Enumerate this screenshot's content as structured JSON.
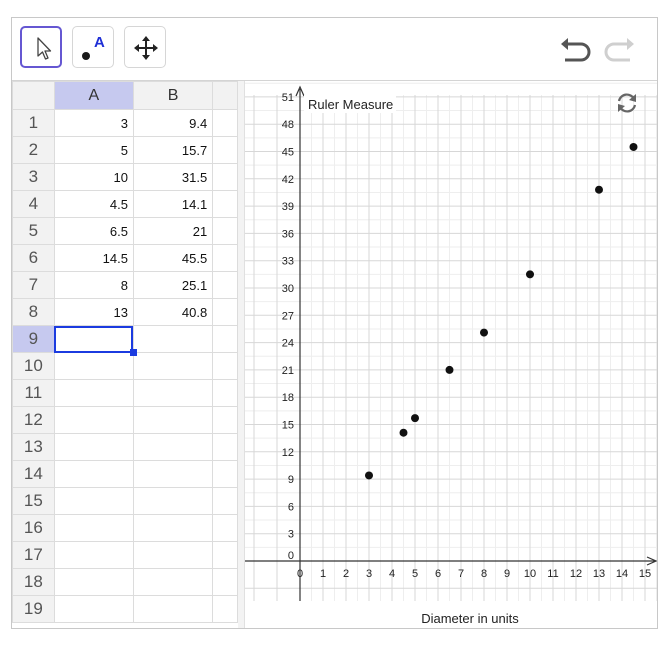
{
  "toolbar": {
    "tools": [
      {
        "name": "move-tool",
        "icon": "cursor-arrow-icon",
        "selected": true
      },
      {
        "name": "point-tool",
        "icon": "point-icon",
        "label": "A",
        "selected": false
      },
      {
        "name": "move-graphics-tool",
        "icon": "move-arrows-icon",
        "selected": false
      }
    ],
    "undo_icon": "undo-icon",
    "redo_icon": "redo-icon",
    "accent": "#6557d2"
  },
  "spreadsheet": {
    "columns": [
      "A",
      "B"
    ],
    "rows": [
      {
        "n": "1",
        "a": "3",
        "b": "9.4"
      },
      {
        "n": "2",
        "a": "5",
        "b": "15.7"
      },
      {
        "n": "3",
        "a": "10",
        "b": "31.5"
      },
      {
        "n": "4",
        "a": "4.5",
        "b": "14.1"
      },
      {
        "n": "5",
        "a": "6.5",
        "b": "21"
      },
      {
        "n": "6",
        "a": "14.5",
        "b": "45.5"
      },
      {
        "n": "7",
        "a": "8",
        "b": "25.1"
      },
      {
        "n": "8",
        "a": "13",
        "b": "40.8"
      },
      {
        "n": "9",
        "a": "",
        "b": ""
      },
      {
        "n": "10",
        "a": "",
        "b": ""
      },
      {
        "n": "11",
        "a": "",
        "b": ""
      },
      {
        "n": "12",
        "a": "",
        "b": ""
      },
      {
        "n": "13",
        "a": "",
        "b": ""
      },
      {
        "n": "14",
        "a": "",
        "b": ""
      },
      {
        "n": "15",
        "a": "",
        "b": ""
      },
      {
        "n": "16",
        "a": "",
        "b": ""
      },
      {
        "n": "17",
        "a": "",
        "b": ""
      },
      {
        "n": "18",
        "a": "",
        "b": ""
      },
      {
        "n": "19",
        "a": "",
        "b": ""
      }
    ],
    "selected_cell": "A9",
    "header_highlight": "#c6c9ef",
    "selection_color": "#1b3be0"
  },
  "graphics": {
    "refresh_icon": "refresh-icon"
  },
  "chart_data": {
    "type": "scatter",
    "title": "",
    "ylabel": "Ruler Measure",
    "xlabel": "Diameter in units",
    "xlim": [
      0,
      15
    ],
    "ylim": [
      0,
      51
    ],
    "xticks": [
      0,
      1,
      2,
      3,
      4,
      5,
      6,
      7,
      8,
      9,
      10,
      11,
      12,
      13,
      14,
      15
    ],
    "yticks": [
      0,
      3,
      6,
      9,
      12,
      15,
      18,
      21,
      24,
      27,
      30,
      33,
      36,
      39,
      42,
      45,
      48,
      51
    ],
    "grid": true,
    "points": [
      {
        "x": 3,
        "y": 9.4
      },
      {
        "x": 5,
        "y": 15.7
      },
      {
        "x": 10,
        "y": 31.5
      },
      {
        "x": 4.5,
        "y": 14.1
      },
      {
        "x": 6.5,
        "y": 21
      },
      {
        "x": 14.5,
        "y": 45.5
      },
      {
        "x": 8,
        "y": 25.1
      },
      {
        "x": 13,
        "y": 40.8
      }
    ]
  }
}
